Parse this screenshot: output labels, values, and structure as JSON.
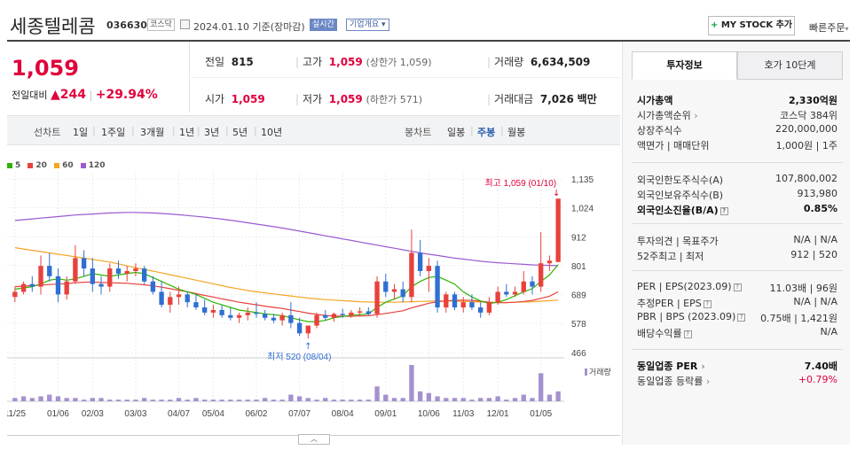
{
  "header": {
    "stock_name": "세종텔레콤",
    "stock_code": "036630",
    "market": "코스닥",
    "date_text": "2024.01.10 기준(장마감)",
    "realtime_button": "실시간",
    "overview_button": "기업개요",
    "overview_arrow": "▾",
    "mystock_plus": "+",
    "mystock_label": "MY STOCK 추가",
    "quick_order": "빠른주문",
    "quick_order_arrow": "▾"
  },
  "price": {
    "current": "1,059",
    "change_label": "전일대비",
    "change_arrow": "▲",
    "change_value": "244",
    "change_sep": "|",
    "change_pct": "+29.94%"
  },
  "stats": {
    "prev_close_label": "전일",
    "prev_close": "815",
    "high_label": "고가",
    "high": "1,059",
    "high_limit": "(상한가 1,059)",
    "volume_label": "거래량",
    "volume": "6,634,509",
    "open_label": "시가",
    "open": "1,059",
    "low_label": "저가",
    "low": "1,059",
    "low_limit": "(하한가 571)",
    "amount_label": "거래대금",
    "amount": "7,026",
    "amount_unit": "백만"
  },
  "period_bar": {
    "line_chart_label": "선차트",
    "line_periods": [
      "1일",
      "1주일",
      "3개월",
      "1년",
      "3년",
      "5년",
      "10년"
    ],
    "candle_label": "봉차트",
    "candle_periods": [
      "일봉",
      "주봉",
      "월봉"
    ],
    "candle_selected": "주봉"
  },
  "legend": [
    {
      "label": "5",
      "color": "#2db400"
    },
    {
      "label": "20",
      "color": "#e8413c"
    },
    {
      "label": "60",
      "color": "#f5a524"
    },
    {
      "label": "120",
      "color": "#9b59d0"
    }
  ],
  "chart_data": {
    "type": "candlestick",
    "interval": "weekly",
    "yaxis_ticks": [
      "1,135",
      "1,024",
      "912",
      "801",
      "689",
      "578",
      "466"
    ],
    "ylim": [
      466,
      1135
    ],
    "xaxis_ticks": [
      "11/25",
      "01/06",
      "02/03",
      "03/03",
      "04/07",
      "05/04",
      "06/02",
      "07/07",
      "08/04",
      "09/01",
      "10/06",
      "11/03",
      "12/01",
      "01/05"
    ],
    "high_annotation": "최고 1,059 (01/10)",
    "low_annotation": "최저 520 (08/04)",
    "volume_label": "거래량",
    "candles": [
      [
        680,
        720,
        660,
        700
      ],
      [
        700,
        740,
        690,
        730
      ],
      [
        730,
        760,
        700,
        720
      ],
      [
        720,
        840,
        690,
        800
      ],
      [
        800,
        850,
        740,
        760
      ],
      [
        760,
        790,
        660,
        690
      ],
      [
        690,
        760,
        670,
        740
      ],
      [
        740,
        880,
        730,
        830
      ],
      [
        830,
        860,
        760,
        790
      ],
      [
        790,
        830,
        700,
        730
      ],
      [
        730,
        760,
        690,
        720
      ],
      [
        720,
        810,
        700,
        790
      ],
      [
        790,
        820,
        750,
        770
      ],
      [
        770,
        800,
        740,
        780
      ],
      [
        780,
        810,
        760,
        790
      ],
      [
        790,
        800,
        730,
        740
      ],
      [
        740,
        760,
        690,
        700
      ],
      [
        700,
        740,
        640,
        650
      ],
      [
        650,
        700,
        620,
        680
      ],
      [
        680,
        720,
        650,
        690
      ],
      [
        690,
        700,
        640,
        660
      ],
      [
        660,
        690,
        630,
        640
      ],
      [
        640,
        670,
        610,
        620
      ],
      [
        620,
        650,
        600,
        630
      ],
      [
        630,
        650,
        600,
        610
      ],
      [
        610,
        640,
        590,
        600
      ],
      [
        600,
        620,
        580,
        610
      ],
      [
        610,
        640,
        590,
        620
      ],
      [
        620,
        660,
        600,
        615
      ],
      [
        615,
        630,
        590,
        600
      ],
      [
        600,
        615,
        580,
        590
      ],
      [
        590,
        620,
        570,
        610
      ],
      [
        610,
        660,
        560,
        580
      ],
      [
        580,
        600,
        530,
        540
      ],
      [
        540,
        560,
        520,
        570
      ],
      [
        570,
        620,
        560,
        610
      ],
      [
        610,
        630,
        590,
        600
      ],
      [
        600,
        620,
        585,
        615
      ],
      [
        615,
        635,
        600,
        610
      ],
      [
        610,
        630,
        600,
        620
      ],
      [
        620,
        640,
        605,
        625
      ],
      [
        625,
        640,
        610,
        615
      ],
      [
        615,
        760,
        600,
        740
      ],
      [
        740,
        770,
        680,
        700
      ],
      [
        700,
        730,
        670,
        710
      ],
      [
        710,
        740,
        660,
        680
      ],
      [
        680,
        940,
        660,
        850
      ],
      [
        850,
        900,
        760,
        780
      ],
      [
        780,
        830,
        700,
        800
      ],
      [
        800,
        820,
        620,
        640
      ],
      [
        640,
        700,
        620,
        690
      ],
      [
        690,
        700,
        630,
        640
      ],
      [
        640,
        680,
        620,
        660
      ],
      [
        660,
        690,
        630,
        640
      ],
      [
        640,
        660,
        600,
        620
      ],
      [
        620,
        680,
        610,
        660
      ],
      [
        660,
        720,
        650,
        700
      ],
      [
        700,
        730,
        680,
        690
      ],
      [
        690,
        720,
        680,
        700
      ],
      [
        700,
        780,
        690,
        740
      ],
      [
        740,
        760,
        690,
        720
      ],
      [
        720,
        930,
        700,
        810
      ],
      [
        810,
        840,
        780,
        820
      ],
      [
        815,
        1059,
        815,
        1059
      ]
    ],
    "volumes": [
      2,
      3,
      2,
      3,
      4,
      3,
      2,
      2,
      1,
      2,
      2,
      1,
      1,
      1,
      1,
      2,
      1,
      1,
      1,
      2,
      1,
      2,
      1,
      1,
      1,
      1,
      1,
      1,
      1,
      2,
      1,
      1,
      4,
      3,
      2,
      1,
      2,
      1,
      1,
      1,
      1,
      1,
      9,
      4,
      2,
      2,
      22,
      6,
      5,
      3,
      2,
      2,
      2,
      1,
      2,
      2,
      3,
      1,
      2,
      4,
      2,
      17,
      4,
      6
    ],
    "ma5": [
      710,
      715,
      720,
      730,
      745,
      750,
      745,
      750,
      760,
      770,
      765,
      760,
      765,
      770,
      775,
      770,
      755,
      740,
      725,
      710,
      700,
      690,
      675,
      660,
      650,
      640,
      630,
      625,
      620,
      615,
      612,
      608,
      600,
      592,
      585,
      585,
      590,
      600,
      605,
      610,
      612,
      615,
      640,
      660,
      672,
      685,
      720,
      740,
      755,
      760,
      745,
      730,
      700,
      680,
      665,
      655,
      660,
      670,
      685,
      700,
      712,
      740,
      765,
      805
    ],
    "ma20": [
      720,
      722,
      724,
      726,
      728,
      730,
      732,
      735,
      737,
      738,
      736,
      735,
      734,
      733,
      730,
      727,
      723,
      718,
      712,
      706,
      700,
      693,
      686,
      680,
      673,
      667,
      660,
      655,
      650,
      645,
      640,
      636,
      630,
      624,
      618,
      613,
      609,
      607,
      606,
      606,
      607,
      608,
      612,
      617,
      622,
      627,
      638,
      647,
      656,
      662,
      665,
      667,
      668,
      667,
      664,
      660,
      658,
      658,
      660,
      663,
      667,
      675,
      683,
      700
    ],
    "ma60": [
      870,
      865,
      860,
      855,
      850,
      845,
      840,
      835,
      830,
      825,
      820,
      815,
      808,
      800,
      793,
      786,
      780,
      773,
      766,
      759,
      752,
      745,
      738,
      731,
      724,
      717,
      711,
      705,
      700,
      696,
      692,
      688,
      684,
      680,
      676,
      673,
      670,
      668,
      666,
      664,
      662,
      661,
      660,
      660,
      660,
      661,
      662,
      663,
      664,
      665,
      665,
      664,
      663,
      662,
      661,
      660,
      659,
      659,
      660,
      661,
      662,
      664,
      666,
      668
    ],
    "ma120": [
      975,
      978,
      981,
      984,
      987,
      990,
      993,
      996,
      998,
      1000,
      1002,
      1004,
      1005,
      1006,
      1006,
      1005,
      1004,
      1002,
      1000,
      997,
      994,
      991,
      988,
      984,
      980,
      976,
      971,
      966,
      961,
      956,
      951,
      946,
      940,
      934,
      928,
      922,
      916,
      910,
      904,
      898,
      892,
      886,
      880,
      874,
      868,
      862,
      856,
      850,
      845,
      840,
      835,
      830,
      826,
      822,
      818,
      815,
      812,
      810,
      808,
      806,
      804,
      803,
      802,
      801
    ]
  },
  "panel": {
    "tab_active": "투자정보",
    "tab_other": "호가 10단계",
    "market_cap_label": "시가총액",
    "market_cap": "2,330억원",
    "cap_rank_label": "시가총액순위",
    "cap_rank": "코스닥 384위",
    "shares_label": "상장주식수",
    "shares": "220,000,000",
    "par_label": "액면가 | 매매단위",
    "par": "1,000원 | 1주",
    "foreign_limit_label": "외국인한도주식수(A)",
    "foreign_limit": "107,800,002",
    "foreign_own_label": "외국인보유주식수(B)",
    "foreign_own": "913,980",
    "foreign_ratio_label": "외국인소진율(B/A)",
    "foreign_ratio": "0.85%",
    "opinion_label": "투자의견 | 목표주가",
    "opinion": "N/A | N/A",
    "week52_label": "52주최고 | 최저",
    "week52": "912 | 520",
    "per_label": "PER | EPS(2023.09)",
    "per": "11.03배 | 96원",
    "est_per_label": "추정PER | EPS",
    "est_per": "N/A | N/A",
    "pbr_label": "PBR | BPS (2023.09)",
    "pbr": "0.75배 | 1,421원",
    "div_label": "배당수익률",
    "div": "N/A",
    "sector_per_label": "동일업종 PER",
    "sector_per": "7.40배",
    "sector_change_label": "동일업종 등락률",
    "sector_change": "+0.79%",
    "arrow_small": "›",
    "help_mark": "?"
  }
}
